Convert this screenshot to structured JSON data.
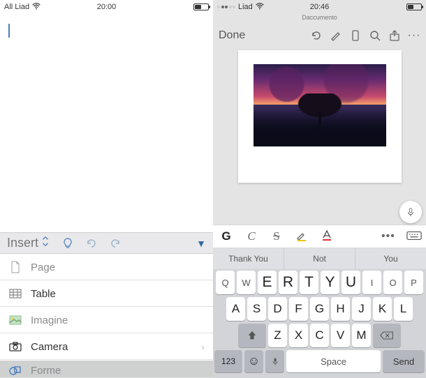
{
  "left": {
    "statusbar": {
      "carrier": "All Liad",
      "time": "20:00"
    },
    "insert_menu": {
      "title": "Insert",
      "items": [
        {
          "label": "Page",
          "icon": "page-icon"
        },
        {
          "label": "Table",
          "icon": "table-icon"
        },
        {
          "label": "Imagine",
          "icon": "image-icon"
        },
        {
          "label": "Camera",
          "icon": "camera-icon"
        },
        {
          "label": "Forme",
          "icon": "shapes-icon"
        }
      ]
    }
  },
  "right": {
    "statusbar": {
      "carrier": "Liad",
      "time": "20:46"
    },
    "doc_title": "Daccumento",
    "done_label": "Done",
    "format": {
      "bold": "G",
      "italic": "C",
      "strike": "S"
    },
    "suggestions": [
      "Thank You",
      "Not",
      "You"
    ],
    "keyboard": {
      "row1": [
        "Q",
        "W",
        "E",
        "R",
        "T",
        "Y",
        "U",
        "I",
        "O",
        "P"
      ],
      "row2": [
        "A",
        "S",
        "D",
        "F",
        "G",
        "H",
        "J",
        "K",
        "L"
      ],
      "row3": [
        "Z",
        "X",
        "C",
        "V",
        "M"
      ],
      "numkey": "123",
      "space": "Space",
      "send": "Send"
    }
  }
}
